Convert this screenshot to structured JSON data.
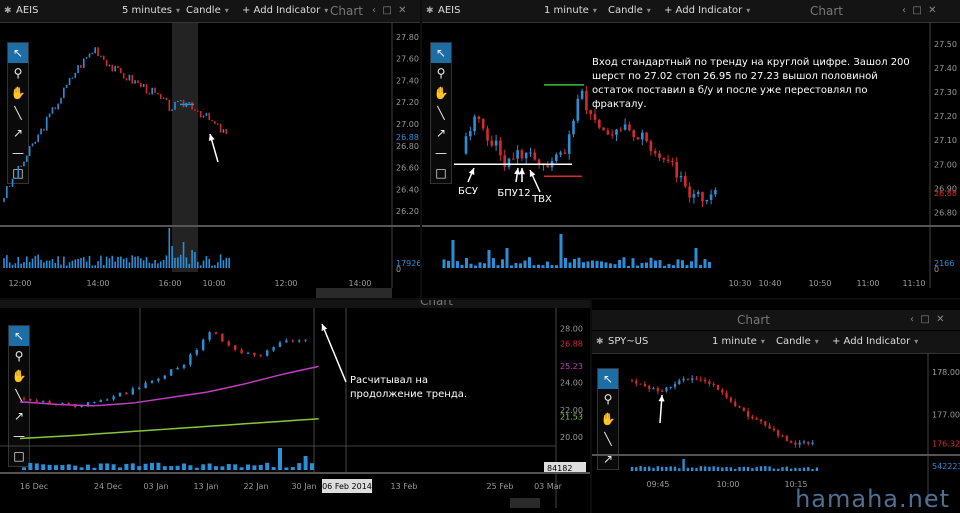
{
  "panels": {
    "p1": {
      "symbol": "AEIS",
      "interval": "5 minutes",
      "type": "Candle",
      "add": "+ Add Indicator",
      "title": "Chart",
      "y_ticks": [
        "27.80",
        "27.60",
        "27.40",
        "27.20",
        "27.00",
        "26.80",
        "26.60",
        "26.40",
        "26.20"
      ],
      "x_ticks": [
        "12:00",
        "14:00",
        "16:00",
        "10:00",
        "12:00",
        "14:00"
      ],
      "price_tag": "26.88",
      "vol_tag": "17926",
      "zero": "0"
    },
    "p2": {
      "symbol": "AEIS",
      "interval": "1 minute",
      "type": "Candle",
      "add": "+ Add Indicator",
      "title": "Chart",
      "y_ticks": [
        "27.50",
        "27.40",
        "27.30",
        "27.20",
        "27.10",
        "27.00",
        "26.90",
        "26.80"
      ],
      "x_ticks": [
        "10:30",
        "10:40",
        "10:50",
        "11:00",
        "11:10"
      ],
      "price_tag": "26.88",
      "vol_tag": "2166",
      "zero": "0",
      "note": "Вход стандартный по тренду на круглой цифре. Зашол 200 шерст по 27.02 стоп 26.95 по 27.23 вышол половиной остаток поставил в б/у и после уже перестовлял по фракталу.",
      "labels": {
        "bsu": "БСУ",
        "bpu": "БПУ12",
        "tvh": "ТВХ"
      }
    },
    "p3": {
      "title": "Chart",
      "y_ticks": [
        "28.00",
        "24.00",
        "22.00",
        "20.00"
      ],
      "x_ticks": [
        "16 Dec",
        "24 Dec",
        "03 Jan",
        "13 Jan",
        "22 Jan",
        "30 Jan",
        "13 Feb",
        "25 Feb",
        "03 Mar"
      ],
      "date_tag": "06 Feb 2014",
      "price_tags": {
        "last": "26.88",
        "ma_magenta": "25.23",
        "ma_green": "21.53"
      },
      "vol_tag": "84182",
      "note": "Расчитывал на продолжение тренда."
    },
    "p4": {
      "symbol": "SPY~US",
      "interval": "1 minute",
      "type": "Candle",
      "add": "+ Add Indicator",
      "title": "Chart",
      "y_ticks": [
        "178.00",
        "177.00"
      ],
      "x_ticks": [
        "09:45",
        "10:00",
        "10:15"
      ],
      "price_tag": "176.32",
      "vol_tag": "542223"
    }
  },
  "watermark": "hamaha.net",
  "colors": {
    "up": "#2a8fd6",
    "down": "#d42a2a",
    "ma_magenta": "#c03ec0",
    "ma_green": "#8ac63a",
    "level": "#ffffff",
    "stop": "#d42a2a",
    "target": "#37c237"
  }
}
